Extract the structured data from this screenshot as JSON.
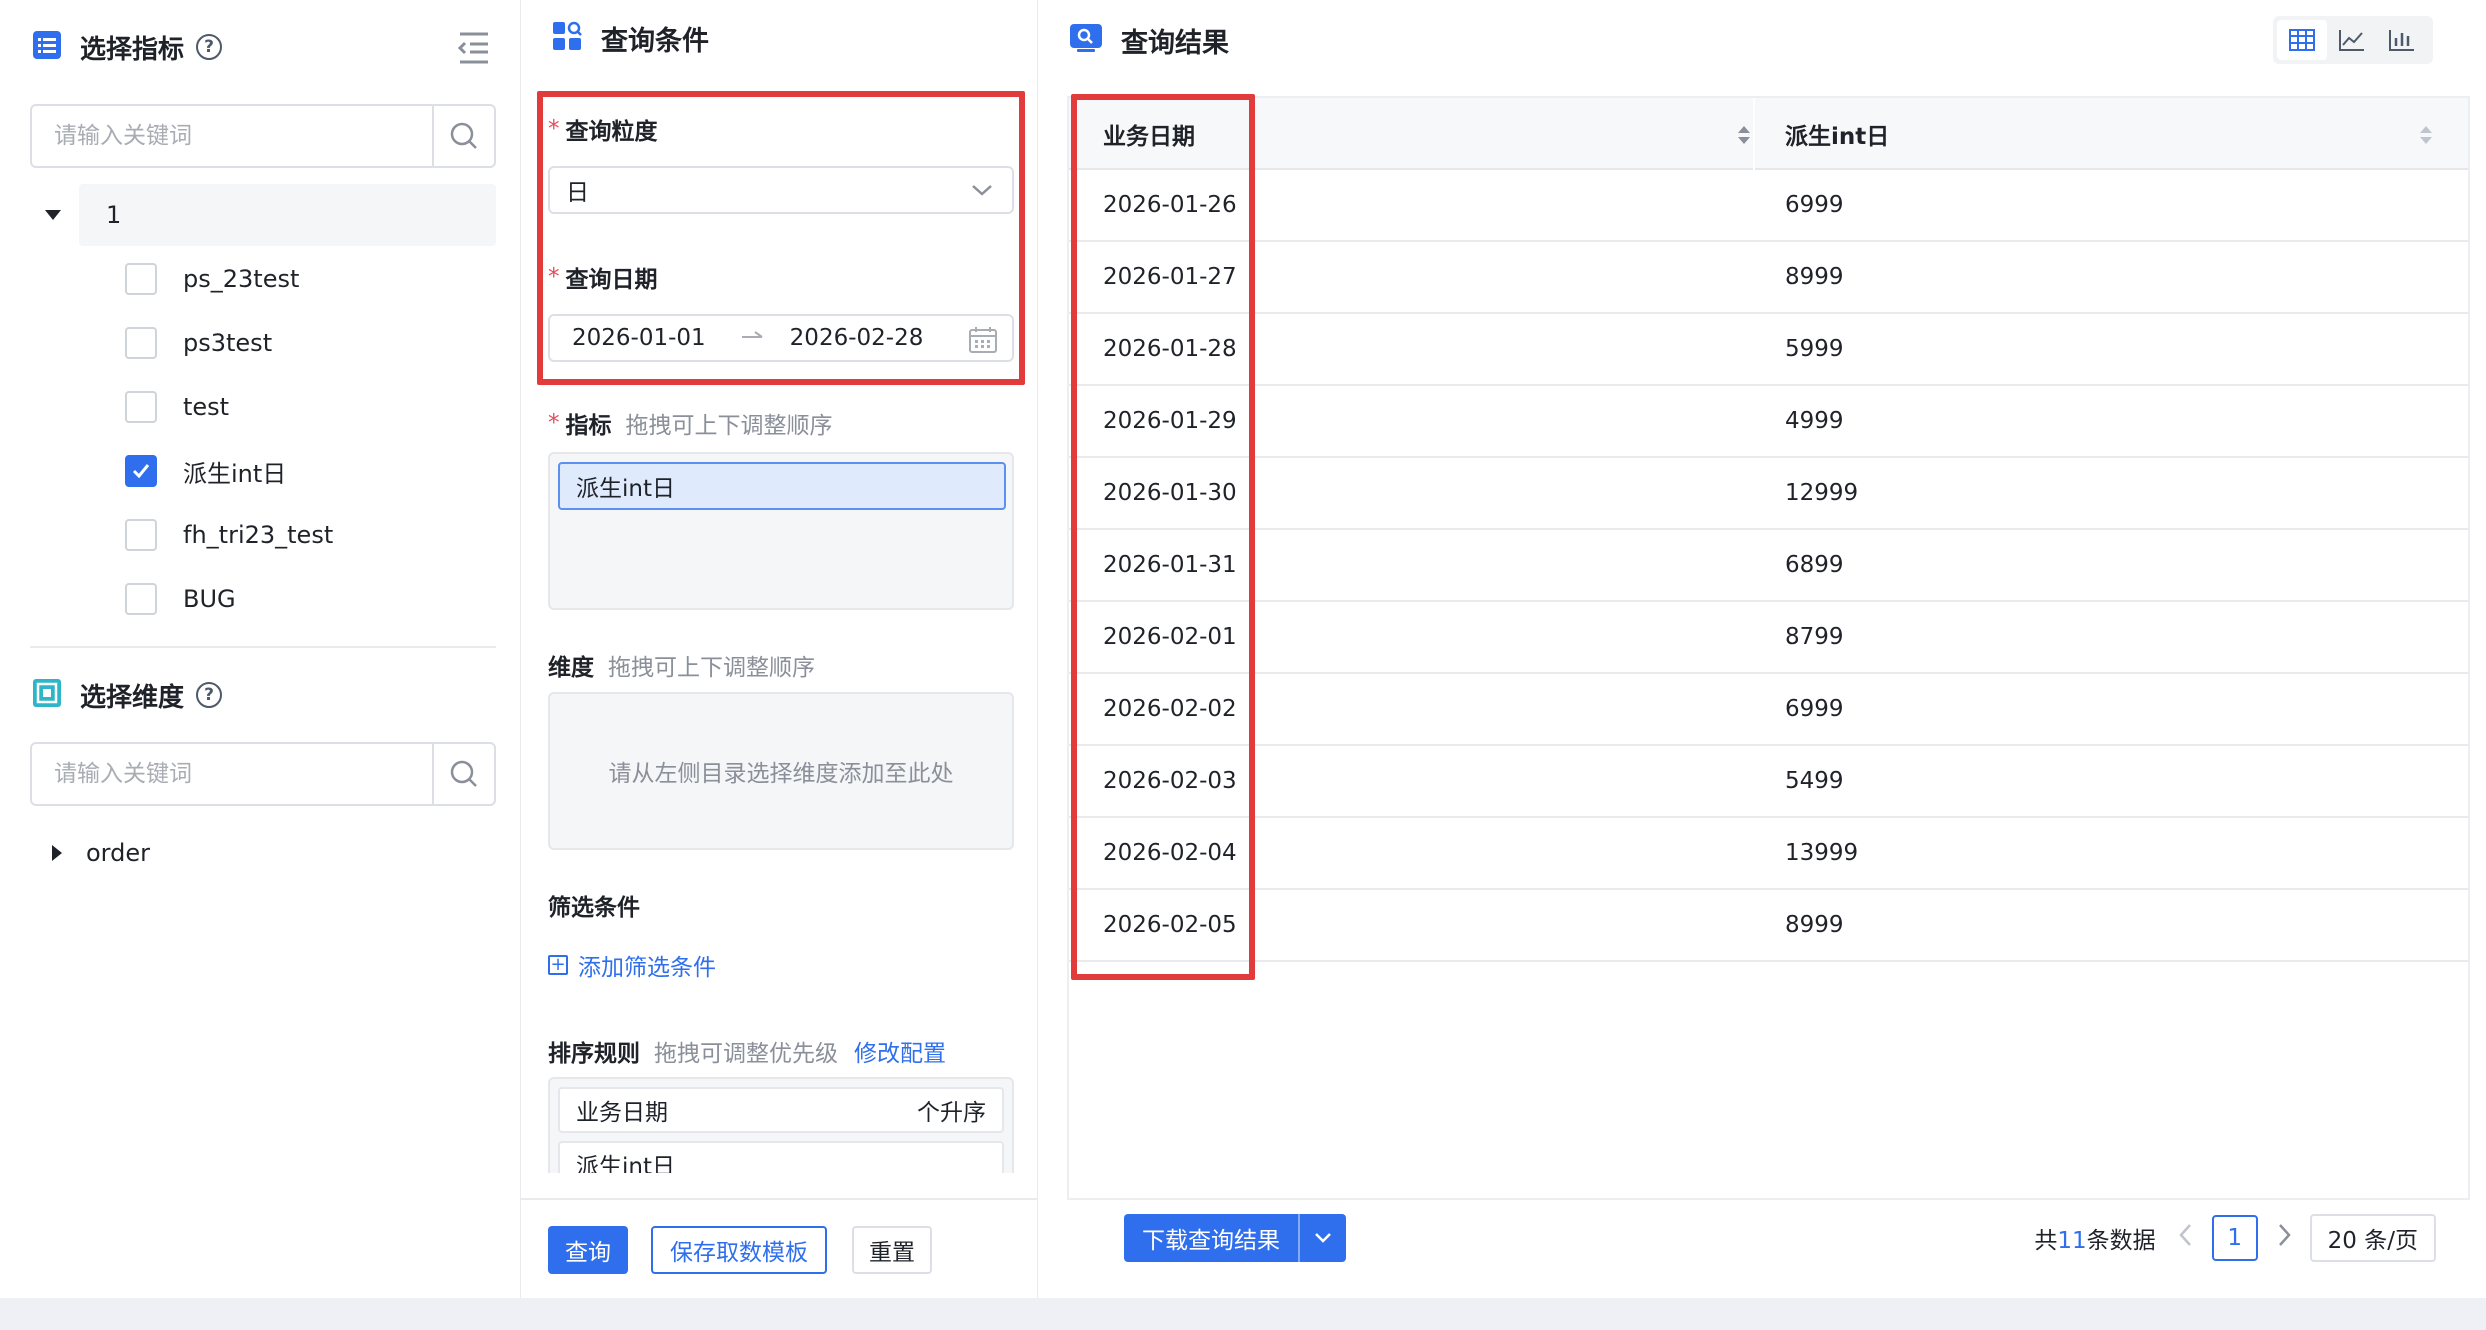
{
  "left": {
    "metrics_title": "选择指标",
    "metrics_search_placeholder": "请输入关键词",
    "tree_root_label": "1",
    "metrics": [
      {
        "label": "ps_23test",
        "checked": false
      },
      {
        "label": "ps3test",
        "checked": false
      },
      {
        "label": "test",
        "checked": false
      },
      {
        "label": "派生int日",
        "checked": true
      },
      {
        "label": "fh_tri23_test",
        "checked": false
      },
      {
        "label": "BUG",
        "checked": false
      }
    ],
    "dimensions_title": "选择维度",
    "dimensions_search_placeholder": "请输入关键词",
    "dimension_group": "order"
  },
  "query": {
    "title": "查询条件",
    "granularity_label": "查询粒度",
    "granularity_value": "日",
    "date_label": "查询日期",
    "date_start": "2026-01-01",
    "date_end": "2026-02-28",
    "metric_label": "指标",
    "metric_hint": "拖拽可上下调整顺序",
    "selected_metric": "派生int日",
    "dimension_label": "维度",
    "dimension_hint": "拖拽可上下调整顺序",
    "dimension_placeholder": "请从左侧目录选择维度添加至此处",
    "filter_label": "筛选条件",
    "add_filter": "添加筛选条件",
    "sort_label": "排序规则",
    "sort_hint": "拖拽可调整优先级",
    "sort_edit": "修改配置",
    "sort_items": [
      {
        "field": "业务日期",
        "direction": "个升序"
      },
      {
        "field": "派生int日",
        "direction": ""
      }
    ],
    "buttons": {
      "query": "查询",
      "save_template": "保存取数模板",
      "reset": "重置"
    }
  },
  "result": {
    "title": "查询结果",
    "columns": [
      "业务日期",
      "派生int日"
    ],
    "rows": [
      [
        "2026-01-26",
        "6999"
      ],
      [
        "2026-01-27",
        "8999"
      ],
      [
        "2026-01-28",
        "5999"
      ],
      [
        "2026-01-29",
        "4999"
      ],
      [
        "2026-01-30",
        "12999"
      ],
      [
        "2026-01-31",
        "6899"
      ],
      [
        "2026-02-01",
        "8799"
      ],
      [
        "2026-02-02",
        "6999"
      ],
      [
        "2026-02-03",
        "5499"
      ],
      [
        "2026-02-04",
        "13999"
      ],
      [
        "2026-02-05",
        "8999"
      ]
    ],
    "download_label": "下载查询结果",
    "total_prefix": "共",
    "total_count": "11",
    "total_suffix": "条数据",
    "current_page": "1",
    "page_size": "20 条/页"
  },
  "colors": {
    "accent": "#2f6fed",
    "highlight_box": "#e23b3b",
    "required_mark": "#e34d59"
  }
}
